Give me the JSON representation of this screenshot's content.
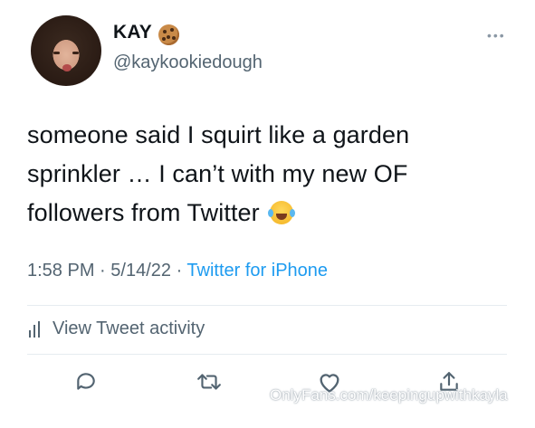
{
  "tweet": {
    "display_name": "KAY",
    "name_emoji_icon": "cookie-icon",
    "handle": "@kaykookiedough",
    "text": "someone said I squirt like a garden sprinkler … I can’t with my new OF followers from Twitter",
    "text_emoji_icon": "face-with-tears-of-joy-icon",
    "time": "1:58 PM",
    "date": "5/14/22",
    "source": "Twitter for iPhone",
    "activity_label": "View Tweet activity"
  },
  "actions": [
    {
      "name": "reply-icon"
    },
    {
      "name": "retweet-icon"
    },
    {
      "name": "like-icon"
    },
    {
      "name": "share-icon"
    }
  ],
  "watermark": "OnlyFans.com/keepingupwithkayla",
  "colors": {
    "text": "#0f1419",
    "secondary": "#536471",
    "link": "#1d9bf0",
    "divider": "#e6ecf0"
  }
}
